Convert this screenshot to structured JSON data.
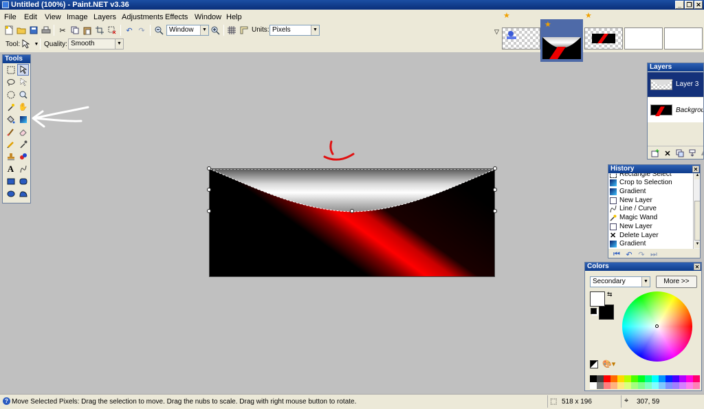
{
  "window": {
    "title": "Untitled (100%) - Paint.NET v3.36"
  },
  "menu": [
    "File",
    "Edit",
    "View",
    "Image",
    "Layers",
    "Adjustments",
    "Effects",
    "Window",
    "Help"
  ],
  "toolbar": {
    "zoom_value": "Window",
    "units_label": "Units:",
    "units_value": "Pixels",
    "tool_label": "Tool:",
    "quality_label": "Quality:",
    "quality_value": "Smooth"
  },
  "tools": {
    "title": "Tools"
  },
  "layers": {
    "title": "Layers",
    "items": [
      {
        "name": "Layer 3",
        "selected": true
      },
      {
        "name": "Background",
        "selected": false
      }
    ]
  },
  "history": {
    "title": "History",
    "items": [
      "Rectangle Select",
      "Crop to Selection",
      "Gradient",
      "New Layer",
      "Line / Curve",
      "Magic Wand",
      "New Layer",
      "Delete Layer",
      "Gradient"
    ]
  },
  "colors": {
    "title": "Colors",
    "mode": "Secondary",
    "more_button": "More >>",
    "primary": "#ffffff",
    "secondary": "#000000",
    "palette": [
      "#000000",
      "#404040",
      "#ff0000",
      "#ff6a00",
      "#ffd800",
      "#b6ff00",
      "#4cff00",
      "#00ff21",
      "#00ff90",
      "#00ffff",
      "#0094ff",
      "#0026ff",
      "#4800ff",
      "#b200ff",
      "#ff00dc",
      "#ff006e",
      "#ffffff",
      "#808080",
      "#ff7f7f",
      "#ffb27f",
      "#ffe97f",
      "#daff7f",
      "#a5ff7f",
      "#7fff8e",
      "#7fffc5",
      "#7fffff",
      "#7fc9ff",
      "#7f92ff",
      "#a17fff",
      "#d67fff",
      "#ff7fed",
      "#ff7fb6"
    ]
  },
  "status": {
    "message": "Move Selected Pixels: Drag the selection to move. Drag the nubs to scale. Drag with right mouse button to rotate.",
    "selection_size": "518 x 196",
    "cursor_position": "307, 59"
  },
  "annotation_colors": {
    "arrow": "#ffffff",
    "smile": "#e01010"
  }
}
